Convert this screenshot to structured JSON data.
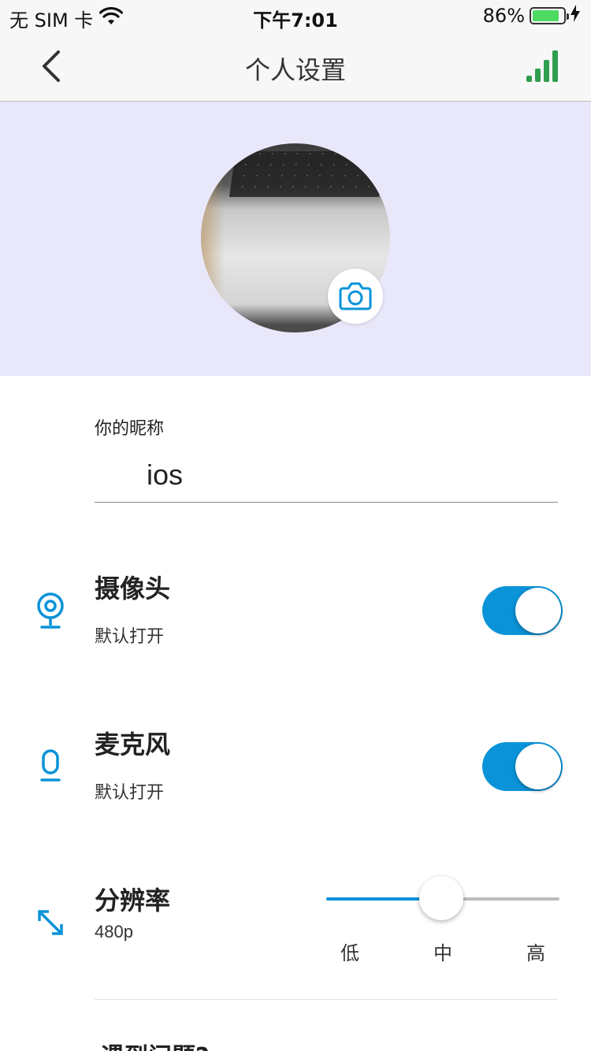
{
  "status_bar": {
    "carrier": "无 SIM 卡",
    "time": "下午7:01",
    "battery_percent": "86%",
    "battery_level": 0.86,
    "battery_color": "#4cd964"
  },
  "nav": {
    "title": "个人设置",
    "back_icon": "chevron-left-icon",
    "signal_icon": "signal-bars-icon",
    "signal_color": "#2e9e4f"
  },
  "avatar": {
    "background_color": "#e9e8fb",
    "camera_icon": "camera-icon",
    "accent": "#0a93d8"
  },
  "nickname": {
    "label": "你的昵称",
    "value": "ios"
  },
  "camera_setting": {
    "title": "摄像头",
    "subtitle": "默认打开",
    "enabled": true,
    "icon": "webcam-icon"
  },
  "mic_setting": {
    "title": "麦克风",
    "subtitle": "默认打开",
    "enabled": true,
    "icon": "microphone-icon"
  },
  "resolution_setting": {
    "title": "分辨率",
    "value": "480p",
    "icon": "resize-arrows-icon",
    "options": [
      "低",
      "中",
      "高"
    ],
    "selected_index": 1,
    "level_fraction": 0.5
  },
  "help": {
    "text": "遇到问题?"
  },
  "colors": {
    "accent": "#0a93d8",
    "toggle_on": "#0a93d8"
  }
}
